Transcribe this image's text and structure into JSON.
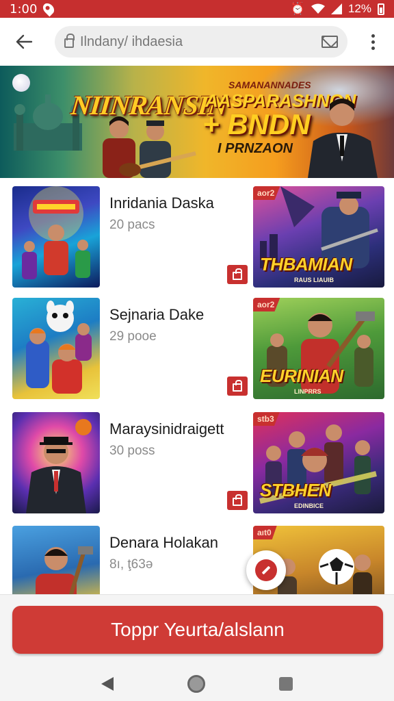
{
  "status_bar": {
    "time": "1:00",
    "battery_text": "12%"
  },
  "app_bar": {
    "url": "Ilndany/ ihdaesia"
  },
  "hero": {
    "title_left": "NIINRANSIN",
    "tagline_small": "SAMANANNADES",
    "tagline_mid": "AASPARASHNON",
    "tagline_big": "+ BNDN",
    "tagline_bottom": "I PRNZAON"
  },
  "list": {
    "items": [
      {
        "title": "Inridania Daska",
        "subtitle": "20 pacs",
        "badge": "aor2",
        "poster_title": "THBAMIAN",
        "poster_sub": "RAUS LIAUIB"
      },
      {
        "title": "Sejnaria Dake",
        "subtitle": "29 pooe",
        "badge": "aor2",
        "poster_title": "EURINIAN",
        "poster_sub": "LINPRRS"
      },
      {
        "title": "Maraysinidraigett",
        "subtitle": "30 poss",
        "badge": "stb3",
        "poster_title": "STBHEN",
        "poster_sub": "EDINBICE"
      },
      {
        "title": "Denara Holakan",
        "subtitle": "8ı, ţ63ə",
        "badge": "aıt0",
        "poster_title": "",
        "poster_sub": ""
      }
    ]
  },
  "cta": {
    "label": "Toppr Yeurta/alslann"
  },
  "colors": {
    "primary": "#c62f2f",
    "cta": "#cf3b36"
  },
  "icons": [
    "back-arrow-icon",
    "lock-icon",
    "mail-icon",
    "more-vert-icon",
    "shopping-bag-icon",
    "edit-icon",
    "nav-back-icon",
    "nav-home-icon",
    "nav-recent-icon"
  ]
}
